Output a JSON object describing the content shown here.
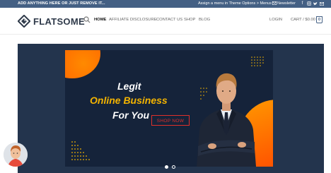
{
  "topbar": {
    "left_text": "ADD ANYTHING HERE OR JUST REMOVE IT...",
    "menu_hint": "Assign a menu in Theme Options > Menus",
    "newsletter": "Newsletter",
    "social_icons": [
      "facebook-icon",
      "instagram-icon",
      "twitter-icon",
      "email-icon"
    ]
  },
  "header": {
    "logo_text": "FLATSOME",
    "nav": [
      "HOME",
      "AFFILIATE DISCLOSURE",
      "CONTACT US",
      "SHOP",
      "BLOG"
    ],
    "active_nav": "HOME",
    "login": "LOGIN",
    "cart": "CART / $0.00",
    "cart_count": "0"
  },
  "hero": {
    "line1": "Legit",
    "line2": "Online Business",
    "line3": "For You",
    "cta": "SHOP NOW",
    "slide_count": 2,
    "active_slide": 1
  },
  "colors": {
    "primary": "#446084",
    "hero_bg": "#23344d",
    "banner_bg": "#15233a",
    "accent_orange": "#ff6a00",
    "headline_gold": "#f4b400",
    "cta_red": "#e0302a"
  }
}
